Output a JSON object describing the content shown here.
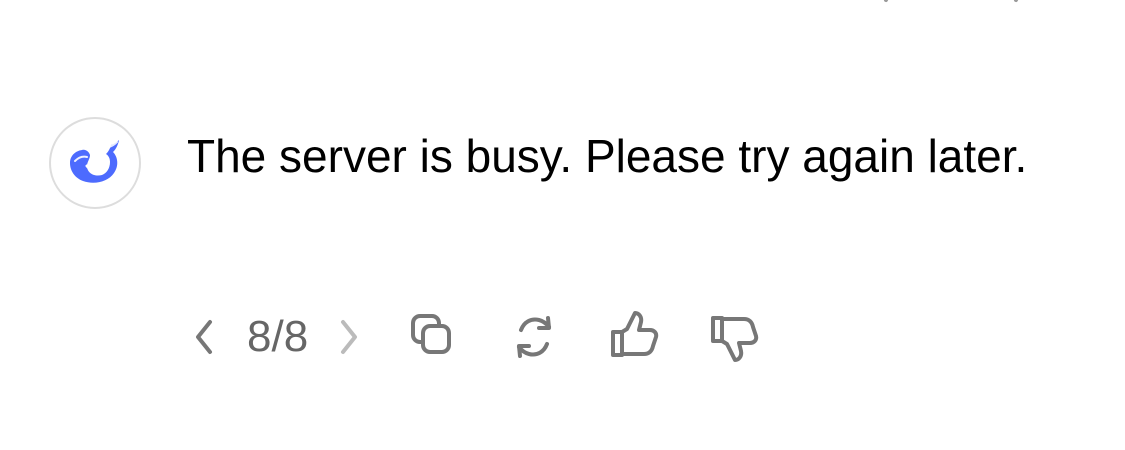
{
  "message": {
    "text": "The server is busy. Please try again later."
  },
  "pager": {
    "current_of_total": "8/8"
  },
  "icons": {
    "avatar": "deepseek-whale-icon",
    "prev": "chevron-left-icon",
    "next": "chevron-right-icon",
    "copy": "copy-icon",
    "regenerate": "refresh-icon",
    "like": "thumbs-up-icon",
    "dislike": "thumbs-down-icon"
  },
  "colors": {
    "brand": "#4D6BFE",
    "icon_gray": "#8A8A8A",
    "text": "#000000",
    "muted_text": "#666666",
    "avatar_border": "#DDDDDD"
  }
}
